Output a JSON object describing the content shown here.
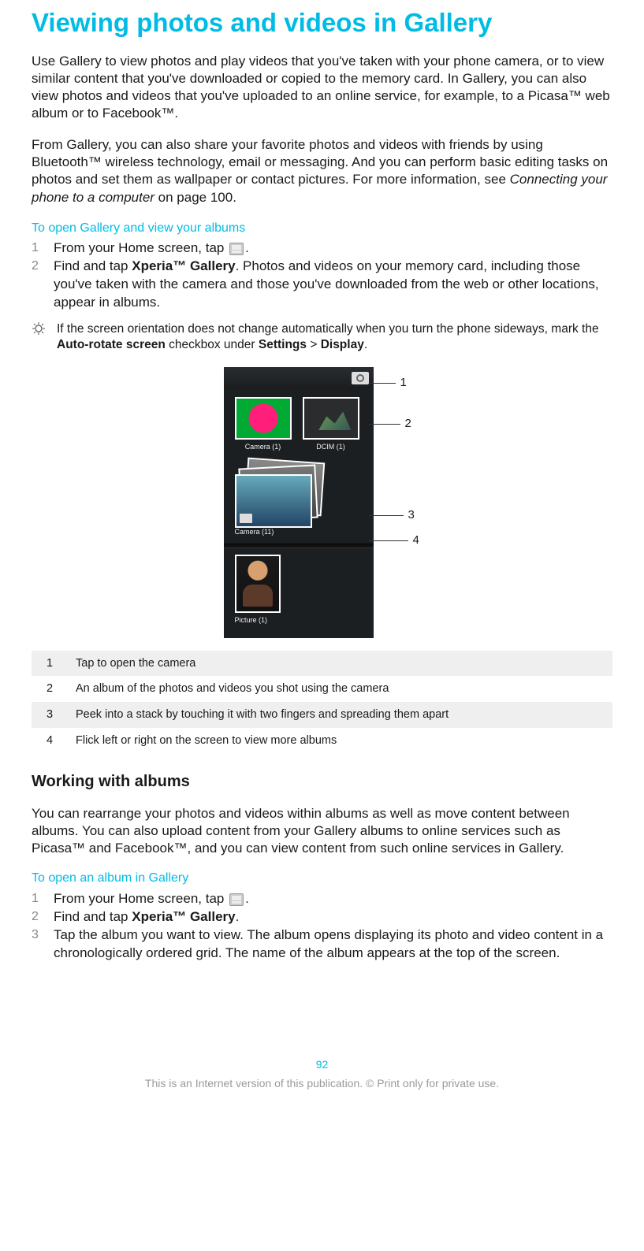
{
  "title": "Viewing photos and videos in Gallery",
  "intro_p1": "Use Gallery to view photos and play videos that you've taken with your phone camera, or to view similar content that you've downloaded or copied to the memory card. In Gallery, you can also view photos and videos that you've uploaded to an online service, for example, to a Picasa™ web album or to Facebook™.",
  "intro_p2_a": "From Gallery, you can also share your favorite photos and videos with friends by using Bluetooth™ wireless technology, email or messaging. And you can perform basic editing tasks on photos and set them as wallpaper or contact pictures. For more information, see ",
  "intro_p2_link": "Connecting your phone to a computer",
  "intro_p2_b": " on page 100.",
  "section1_sub": "To open Gallery and view your albums",
  "steps1": [
    {
      "n": "1",
      "a": "From your Home screen, tap ",
      "b": "."
    },
    {
      "n": "2",
      "a": "Find and tap ",
      "bold": "Xperia™ Gallery",
      "b": ". Photos and videos on your memory card, including those you've taken with the camera and those you've downloaded from the web or other locations, appear in albums."
    }
  ],
  "tip_a": "If the screen orientation does not change automatically when you turn the phone sideways, mark the ",
  "tip_b1": "Auto-rotate screen",
  "tip_c": " checkbox under ",
  "tip_b2": "Settings",
  "tip_d": " > ",
  "tip_b3": "Display",
  "tip_e": ".",
  "figure": {
    "camera_label": "Camera (1)",
    "dcim_label": "DCIM (1)",
    "camera11_label": "Camera (11)",
    "picture_label": "Picture (1)",
    "callouts": [
      "1",
      "2",
      "3",
      "4"
    ]
  },
  "legend": [
    {
      "n": "1",
      "t": "Tap to open the camera"
    },
    {
      "n": "2",
      "t": "An album of the photos and videos you shot using the camera"
    },
    {
      "n": "3",
      "t": "Peek into a stack by touching it with two fingers and spreading them apart"
    },
    {
      "n": "4",
      "t": "Flick left or right on the screen to view more albums"
    }
  ],
  "section2_h": "Working with albums",
  "section2_p": "You can rearrange your photos and videos within albums as well as move content between albums. You can also upload content from your Gallery albums to online services such as Picasa™ and Facebook™, and you can view content from such online services in Gallery.",
  "section2_sub": "To open an album in Gallery",
  "steps2": [
    {
      "n": "1",
      "a": "From your Home screen, tap ",
      "b": "."
    },
    {
      "n": "2",
      "a": "Find and tap ",
      "bold": "Xperia™ Gallery",
      "b": "."
    },
    {
      "n": "3",
      "a": "Tap the album you want to view. The album opens displaying its photo and video content in a chronologically ordered grid. The name of the album appears at the top of the screen."
    }
  ],
  "page_number": "92",
  "footer_note": "This is an Internet version of this publication. © Print only for private use."
}
